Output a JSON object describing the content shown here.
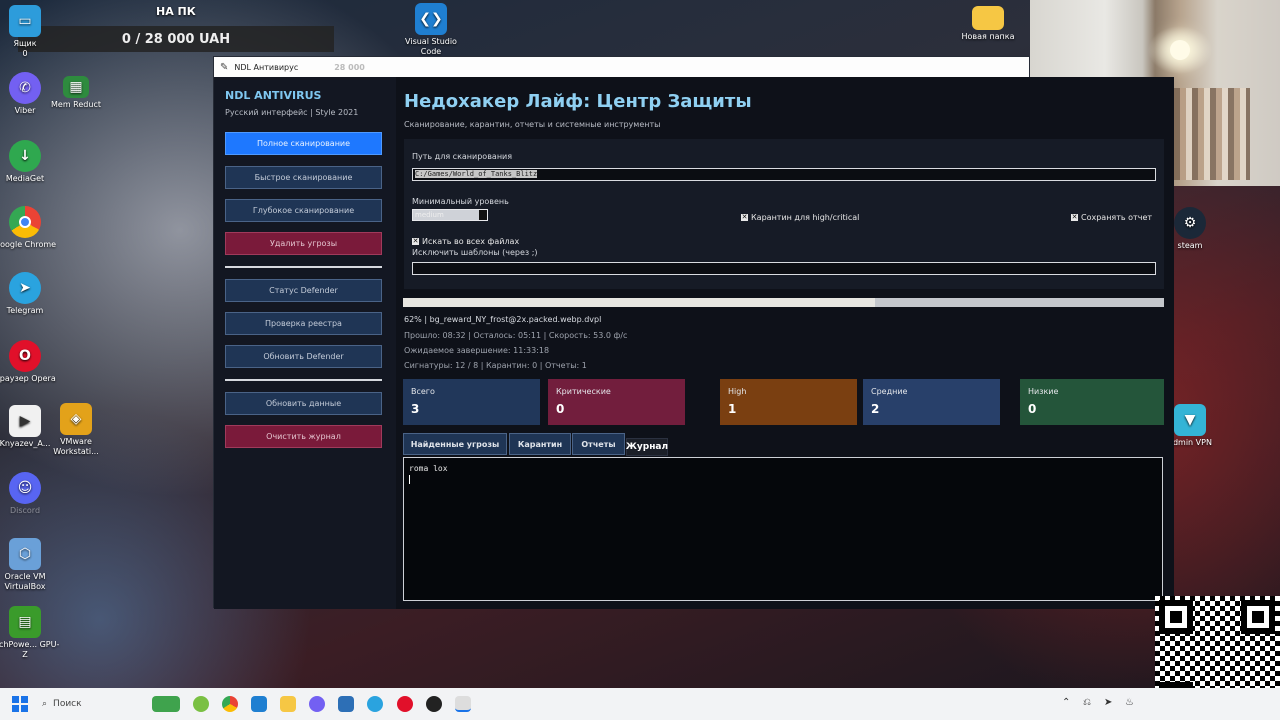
{
  "donation": {
    "top_label": "НА ПК",
    "amount": "0 / 28 000 UAH",
    "ghost": "28 000"
  },
  "desktop_icons": [
    {
      "label": "Ящик",
      "sub": "0"
    },
    {
      "label": "Viber"
    },
    {
      "label": "Mem Reduct"
    },
    {
      "label": "MediaGet"
    },
    {
      "label": "Google Chrome"
    },
    {
      "label": "Telegram"
    },
    {
      "label": "Браузер Opera"
    },
    {
      "label": "Knyazev_A..."
    },
    {
      "label": "VMware Workstati..."
    },
    {
      "label": "Discord"
    },
    {
      "label": "Oracle VM VirtualBox"
    },
    {
      "label": "TechPowe... GPU-Z"
    },
    {
      "label": "Visual Studio Code"
    },
    {
      "label": "Новая папка"
    },
    {
      "label": "steam"
    },
    {
      "label": "admin VPN"
    }
  ],
  "window": {
    "title": "NDL Антивирус"
  },
  "sidebar": {
    "brand": "NDL ANTIVIRUS",
    "subtitle": "Русский интерфейс | Style 2021",
    "buttons": [
      "Полное сканирование",
      "Быстрое сканирование",
      "Глубокое сканирование",
      "Удалить угрозы",
      "Статус Defender",
      "Проверка реестра",
      "Обновить Defender",
      "Обновить данные",
      "Очистить журнал"
    ]
  },
  "main": {
    "title": "Недохакер Лайф: Центр Защиты",
    "subtitle": "Сканирование, карантин, отчеты и системные инструменты",
    "path_label": "Путь для сканирования",
    "path_value": "C:/Games/World_of_Tanks_Blitz",
    "min_level_label": "Минимальный уровень",
    "min_level_value": "medium",
    "quarantine_check": "Карантин для high/critical",
    "save_report_check": "Сохранять отчет",
    "all_files_check": "Искать во всех файлах",
    "exclude_label": "Исключить шаблоны (через ;)",
    "exclude_value": ""
  },
  "progress": {
    "value": 0.62
  },
  "status": {
    "current": "62% | bg_reward_NY_frost@2x.packed.webp.dvpl",
    "times": "Прошло: 08:32 | Осталось: 05:11 | Скорость: 53.0 ф/с",
    "eta": "Ожидаемое завершение: 11:33:18",
    "signatures": "Сигнатуры: 12 / 8 | Карантин: 0 | Отчеты: 1"
  },
  "tiles": [
    {
      "label": "Всего",
      "value": "3",
      "color": "#21375a"
    },
    {
      "label": "Критические",
      "value": "0",
      "color": "#721e3d"
    },
    {
      "label": "High",
      "value": "1",
      "color": "#7a3f11"
    },
    {
      "label": "Средние",
      "value": "2",
      "color": "#28406a"
    },
    {
      "label": "Низкие",
      "value": "0",
      "color": "#24553a"
    }
  ],
  "tabs": [
    "Найденные угрозы",
    "Карантин",
    "Отчеты",
    "Журнал"
  ],
  "log": {
    "text": "roma lox"
  },
  "taskbar": {
    "search_placeholder": "Поиск"
  },
  "colors": {
    "accent": "#1e78ff",
    "title": "#8fd0f2",
    "danger": "#7a1a3a",
    "panel": "#131722"
  }
}
